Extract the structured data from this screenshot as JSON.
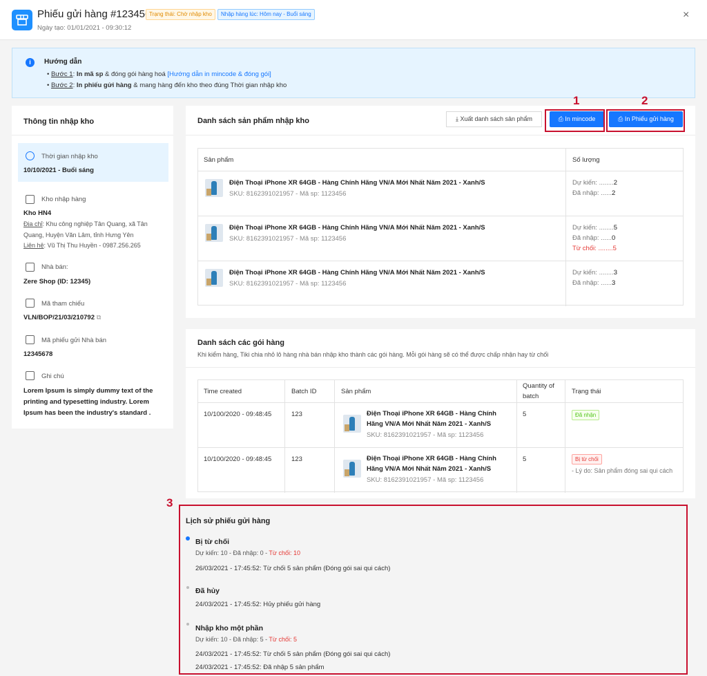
{
  "header": {
    "title": "Phiếu gửi hàng #123456",
    "status_badge": "Trạng thái: Chờ nhập kho",
    "time_badge": "Nhập hàng lúc: Hôm nay - Buổi sáng",
    "created": "Ngày tạo: 01/01/2021 - 09:30:12",
    "close": "×"
  },
  "guide": {
    "title": "Hướng dẫn",
    "step1_label": "Bước 1",
    "step1_bold": "In mã sp",
    "step1_text": "& đóng gói hàng hoá",
    "step1_link": "[Hướng dẫn in mincode & đóng gói]",
    "step2_label": "Bước 2",
    "step2_bold": "In phiếu gửi hàng",
    "step2_text": "& mang hàng đến kho theo đúng Thời gian nhập kho"
  },
  "left": {
    "title": "Thông tin nhập kho",
    "time_label": "Thời gian nhập kho",
    "time_value": "10/10/2021 - Buổi sáng",
    "warehouse_label": "Kho nhập hàng",
    "warehouse_value": "Kho HN4",
    "address_label": "Địa chỉ",
    "address": "Khu công nghiệp Tân Quang, xã Tân Quang, Huyện Văn Lâm, tỉnh Hưng Yên",
    "contact_label": "Liên hệ",
    "contact": "Vũ Thị Thu Huyền - 0987.256.265",
    "seller_label": "Nhà bán:",
    "seller_value": "Zere Shop (ID: 12345)",
    "ref_label": "Mã tham chiếu",
    "ref_value": "VLN/BOP/21/03/210792",
    "seller_code_label": "Mã phiếu gửi Nhà bán",
    "seller_code_value": "12345678",
    "note_label": "Ghi chú",
    "note_value": "Lorem Ipsum is simply dummy text of the printing and typesetting industry. Lorem Ipsum has been the industry's standard ."
  },
  "products": {
    "title": "Danh sách sản phẩm nhập kho",
    "export_label": "Xuất danh sách sản phẩm",
    "mincode_label": "In mincode",
    "print_label": "In Phiếu gửi hàng",
    "col_product": "Sản phẩm",
    "col_qty": "Số lượng",
    "rows": [
      {
        "name": "Điện Thoại iPhone XR 64GB - Hàng Chính Hãng VN/A Mới Nhất Năm 2021 - Xanh/S",
        "sku": "SKU: 8162391021957 - Mã sp: 1123456",
        "expected_label": "Dự kiến: ........",
        "expected": "2",
        "received_label": "Đã nhập: ......",
        "received": "2"
      },
      {
        "name": "Điện Thoại iPhone XR 64GB - Hàng Chính Hãng VN/A Mới Nhất Năm 2021 - Xanh/S",
        "sku": "SKU: 8162391021957 - Mã sp: 1123456",
        "expected_label": "Dự kiến: ........",
        "expected": "5",
        "received_label": "Đã nhập: ......",
        "received": "0",
        "rejected_label": "Từ chối: ........",
        "rejected": "5"
      },
      {
        "name": "Điện Thoại iPhone XR 64GB - Hàng Chính Hãng VN/A Mới Nhất Năm 2021 - Xanh/S",
        "sku": "SKU: 8162391021957 - Mã sp: 1123456",
        "expected_label": "Dự kiến: ........",
        "expected": "3",
        "received_label": "Đã nhập: ......",
        "received": "3"
      }
    ]
  },
  "packages": {
    "title": "Danh sách các gói hàng",
    "subtitle": "Khi kiểm hàng, Tiki chia nhỏ lô hàng nhà bán nhập kho thành các gói hàng. Mỗi gói hàng sẽ có thể được chấp nhận hay từ chối",
    "col_time": "Time created",
    "col_batch": "Batch ID",
    "col_product": "Sản phẩm",
    "col_qty_1": "Quantity of",
    "col_qty_2": "batch",
    "col_status": "Trạng thái",
    "rows": [
      {
        "time": "10/100/2020 - 09:48:45",
        "batch": "123",
        "name1": "Điện Thoại iPhone XR 64GB - Hàng Chính",
        "name2": "Hãng VN/A Mới Nhất Năm 2021 - Xanh/S",
        "sku": "SKU: 8162391021957 - Mã sp: 1123456",
        "qty": "5",
        "status": "Đã nhận",
        "reason": ""
      },
      {
        "time": "10/100/2020 - 09:48:45",
        "batch": "123",
        "name1": "Điện Thoại iPhone XR 64GB - Hàng Chính",
        "name2": "Hãng VN/A Mới Nhất Năm 2021 - Xanh/S",
        "sku": "SKU: 8162391021957 - Mã sp: 1123456",
        "qty": "5",
        "status": "Bị từ chối",
        "reason": "- Lý do: Sản phẩm đóng sai qui cách"
      }
    ]
  },
  "history": {
    "title": "Lịch sử  phiếu gửi hàng",
    "items": [
      {
        "title": "Bị từ chối",
        "sub_prefix": "Dự kiến: 10 - Đã nhập: 0 - ",
        "sub_red": "Từ chối: 10",
        "lines": [
          "26/03/2021 - 17:45:52: Từ chối 5 sản phẩm (Đóng gói sai qui cách)"
        ]
      },
      {
        "title": "Đã hủy",
        "lines": [
          "24/03/2021 - 17:45:52: Hủy phiếu gửi hàng"
        ]
      },
      {
        "title": "Nhập kho một phần",
        "sub_prefix": "Dự kiến: 10 - Đã nhập: 5 - ",
        "sub_red": "Từ chối: 5",
        "lines": [
          "24/03/2021 - 17:45:52: Từ chối 5 sản phẩm (Đóng gói sai qui cách)",
          "24/03/2021 - 17:45:52: Đã nhập 5 sản phẩm"
        ]
      }
    ]
  },
  "annotations": {
    "n1": "1",
    "n2": "2",
    "n3": "3"
  },
  "colors": {
    "primary": "#1677ff",
    "annotation": "#c8102e",
    "danger": "#e53935",
    "success": "#52c41a"
  }
}
